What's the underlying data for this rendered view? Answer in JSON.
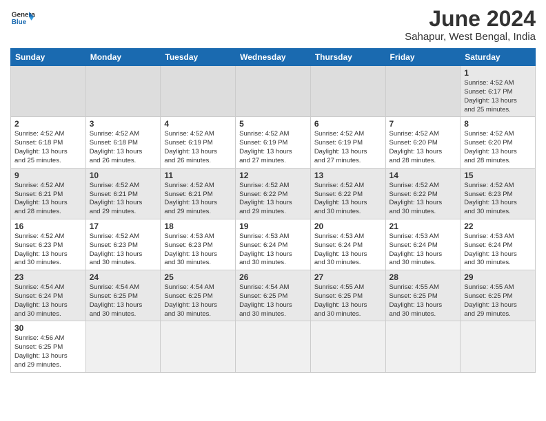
{
  "header": {
    "logo_general": "General",
    "logo_blue": "Blue",
    "month_title": "June 2024",
    "location": "Sahapur, West Bengal, India"
  },
  "weekdays": [
    "Sunday",
    "Monday",
    "Tuesday",
    "Wednesday",
    "Thursday",
    "Friday",
    "Saturday"
  ],
  "weeks": [
    [
      {
        "day": "",
        "info": "",
        "empty": true
      },
      {
        "day": "",
        "info": "",
        "empty": true
      },
      {
        "day": "",
        "info": "",
        "empty": true
      },
      {
        "day": "",
        "info": "",
        "empty": true
      },
      {
        "day": "",
        "info": "",
        "empty": true
      },
      {
        "day": "",
        "info": "",
        "empty": true
      },
      {
        "day": "1",
        "info": "Sunrise: 4:52 AM\nSunset: 6:17 PM\nDaylight: 13 hours\nand 25 minutes.",
        "empty": false
      }
    ],
    [
      {
        "day": "2",
        "info": "Sunrise: 4:52 AM\nSunset: 6:18 PM\nDaylight: 13 hours\nand 25 minutes.",
        "empty": false
      },
      {
        "day": "3",
        "info": "Sunrise: 4:52 AM\nSunset: 6:18 PM\nDaylight: 13 hours\nand 26 minutes.",
        "empty": false
      },
      {
        "day": "4",
        "info": "Sunrise: 4:52 AM\nSunset: 6:19 PM\nDaylight: 13 hours\nand 26 minutes.",
        "empty": false
      },
      {
        "day": "5",
        "info": "Sunrise: 4:52 AM\nSunset: 6:19 PM\nDaylight: 13 hours\nand 27 minutes.",
        "empty": false
      },
      {
        "day": "6",
        "info": "Sunrise: 4:52 AM\nSunset: 6:19 PM\nDaylight: 13 hours\nand 27 minutes.",
        "empty": false
      },
      {
        "day": "7",
        "info": "Sunrise: 4:52 AM\nSunset: 6:20 PM\nDaylight: 13 hours\nand 28 minutes.",
        "empty": false
      },
      {
        "day": "8",
        "info": "Sunrise: 4:52 AM\nSunset: 6:20 PM\nDaylight: 13 hours\nand 28 minutes.",
        "empty": false
      }
    ],
    [
      {
        "day": "9",
        "info": "Sunrise: 4:52 AM\nSunset: 6:21 PM\nDaylight: 13 hours\nand 28 minutes.",
        "empty": false
      },
      {
        "day": "10",
        "info": "Sunrise: 4:52 AM\nSunset: 6:21 PM\nDaylight: 13 hours\nand 29 minutes.",
        "empty": false
      },
      {
        "day": "11",
        "info": "Sunrise: 4:52 AM\nSunset: 6:21 PM\nDaylight: 13 hours\nand 29 minutes.",
        "empty": false
      },
      {
        "day": "12",
        "info": "Sunrise: 4:52 AM\nSunset: 6:22 PM\nDaylight: 13 hours\nand 29 minutes.",
        "empty": false
      },
      {
        "day": "13",
        "info": "Sunrise: 4:52 AM\nSunset: 6:22 PM\nDaylight: 13 hours\nand 30 minutes.",
        "empty": false
      },
      {
        "day": "14",
        "info": "Sunrise: 4:52 AM\nSunset: 6:22 PM\nDaylight: 13 hours\nand 30 minutes.",
        "empty": false
      },
      {
        "day": "15",
        "info": "Sunrise: 4:52 AM\nSunset: 6:23 PM\nDaylight: 13 hours\nand 30 minutes.",
        "empty": false
      }
    ],
    [
      {
        "day": "16",
        "info": "Sunrise: 4:52 AM\nSunset: 6:23 PM\nDaylight: 13 hours\nand 30 minutes.",
        "empty": false
      },
      {
        "day": "17",
        "info": "Sunrise: 4:52 AM\nSunset: 6:23 PM\nDaylight: 13 hours\nand 30 minutes.",
        "empty": false
      },
      {
        "day": "18",
        "info": "Sunrise: 4:53 AM\nSunset: 6:23 PM\nDaylight: 13 hours\nand 30 minutes.",
        "empty": false
      },
      {
        "day": "19",
        "info": "Sunrise: 4:53 AM\nSunset: 6:24 PM\nDaylight: 13 hours\nand 30 minutes.",
        "empty": false
      },
      {
        "day": "20",
        "info": "Sunrise: 4:53 AM\nSunset: 6:24 PM\nDaylight: 13 hours\nand 30 minutes.",
        "empty": false
      },
      {
        "day": "21",
        "info": "Sunrise: 4:53 AM\nSunset: 6:24 PM\nDaylight: 13 hours\nand 30 minutes.",
        "empty": false
      },
      {
        "day": "22",
        "info": "Sunrise: 4:53 AM\nSunset: 6:24 PM\nDaylight: 13 hours\nand 30 minutes.",
        "empty": false
      }
    ],
    [
      {
        "day": "23",
        "info": "Sunrise: 4:54 AM\nSunset: 6:24 PM\nDaylight: 13 hours\nand 30 minutes.",
        "empty": false
      },
      {
        "day": "24",
        "info": "Sunrise: 4:54 AM\nSunset: 6:25 PM\nDaylight: 13 hours\nand 30 minutes.",
        "empty": false
      },
      {
        "day": "25",
        "info": "Sunrise: 4:54 AM\nSunset: 6:25 PM\nDaylight: 13 hours\nand 30 minutes.",
        "empty": false
      },
      {
        "day": "26",
        "info": "Sunrise: 4:54 AM\nSunset: 6:25 PM\nDaylight: 13 hours\nand 30 minutes.",
        "empty": false
      },
      {
        "day": "27",
        "info": "Sunrise: 4:55 AM\nSunset: 6:25 PM\nDaylight: 13 hours\nand 30 minutes.",
        "empty": false
      },
      {
        "day": "28",
        "info": "Sunrise: 4:55 AM\nSunset: 6:25 PM\nDaylight: 13 hours\nand 30 minutes.",
        "empty": false
      },
      {
        "day": "29",
        "info": "Sunrise: 4:55 AM\nSunset: 6:25 PM\nDaylight: 13 hours\nand 29 minutes.",
        "empty": false
      }
    ],
    [
      {
        "day": "30",
        "info": "Sunrise: 4:56 AM\nSunset: 6:25 PM\nDaylight: 13 hours\nand 29 minutes.",
        "empty": false
      },
      {
        "day": "",
        "info": "",
        "empty": true
      },
      {
        "day": "",
        "info": "",
        "empty": true
      },
      {
        "day": "",
        "info": "",
        "empty": true
      },
      {
        "day": "",
        "info": "",
        "empty": true
      },
      {
        "day": "",
        "info": "",
        "empty": true
      },
      {
        "day": "",
        "info": "",
        "empty": true
      }
    ]
  ]
}
